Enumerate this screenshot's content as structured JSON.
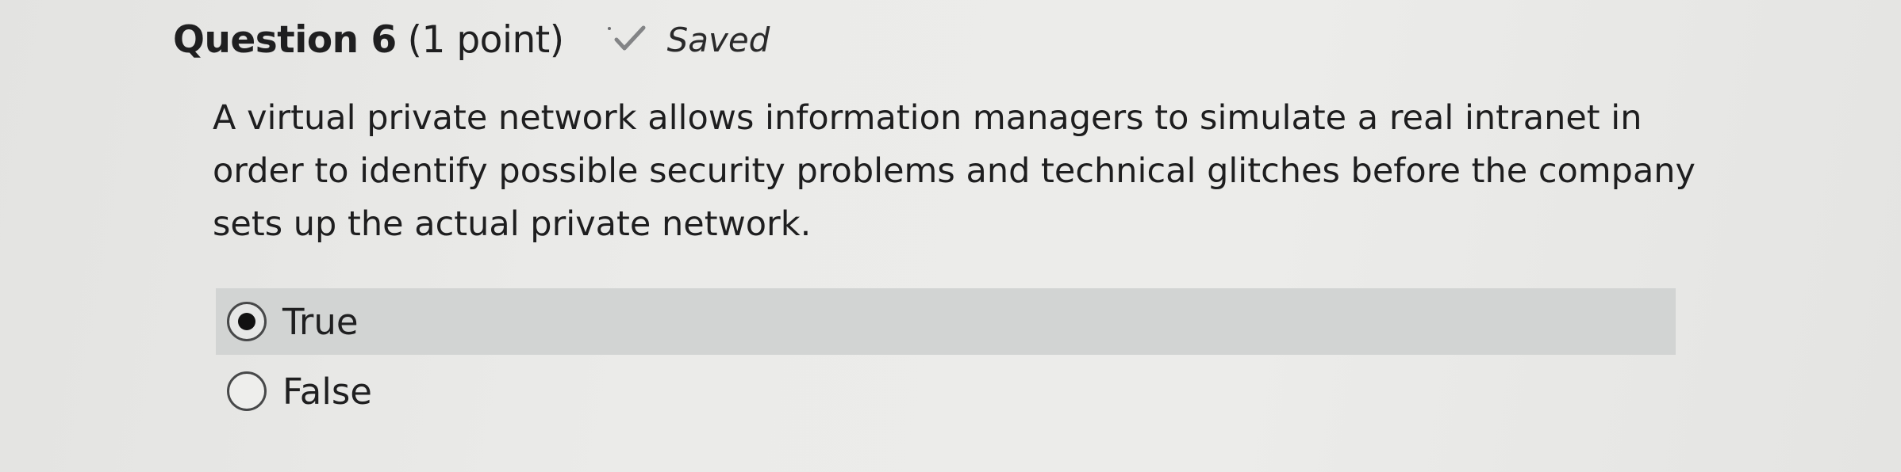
{
  "question": {
    "title": "Question 6",
    "points": "(1 point)",
    "status_label": "Saved",
    "status_icon": "check-icon",
    "text": "A virtual private network allows information managers to simulate a real intranet in order to identify possible security problems and technical glitches before the company sets up the actual private network."
  },
  "answers": [
    {
      "label": "True",
      "selected": true
    },
    {
      "label": "False",
      "selected": false
    }
  ],
  "colors": {
    "background": "#ebebe9",
    "selected_row": "#d2d4d3",
    "text": "#1f1f20"
  }
}
